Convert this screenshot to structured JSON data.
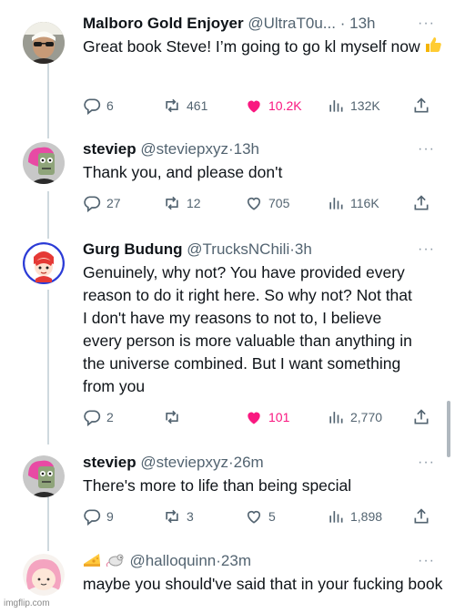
{
  "tweets": [
    {
      "name": "Malboro Gold Enjoyer",
      "handle": "@UltraT0u...",
      "sep": "·",
      "time": "13h",
      "more": "···",
      "text": "Great book Steve! I’m going to go k",
      "text_tail": "l myself now",
      "emoji": "thumbs-up-emoji",
      "replies": "6",
      "reposts": "461",
      "likes": "10.2K",
      "views": "132K",
      "liked": true
    },
    {
      "name": "steviep",
      "handle": "@steviepxyz",
      "sep": "·",
      "time": "13h",
      "more": "···",
      "text": "Thank you, and please don't",
      "replies": "27",
      "reposts": "12",
      "likes": "705",
      "views": "116K",
      "liked": false
    },
    {
      "name": "Gurg Budung",
      "handle": "@TrucksNChili",
      "sep": "·",
      "time": "3h",
      "more": "···",
      "text": "Genuinely, why not? You have provided every reason to do it right here. So why not? Not that I don't have my reasons to not to, I believe every person is more valuable than anything in the universe combined. But I want something from you",
      "replies": "2",
      "reposts": "",
      "likes": "101",
      "views": "2,770",
      "liked": true
    },
    {
      "name": "steviep",
      "handle": "@steviepxyz",
      "sep": "·",
      "time": "26m",
      "more": "···",
      "text": "There's more to life than being special",
      "replies": "9",
      "reposts": "3",
      "likes": "5",
      "views": "1,898",
      "liked": false
    },
    {
      "name": "",
      "handle": "@halloquinn",
      "sep": "·",
      "time": "23m",
      "more": "···",
      "name_emojis": [
        "cheese-emoji",
        "rat-emoji"
      ],
      "text": "maybe you should've said that in your fucking book"
    }
  ],
  "watermark": "imgflip.com",
  "colors": {
    "like_pink": "#f91880",
    "text_gray": "#536471",
    "thread_line": "#cfd9de"
  }
}
